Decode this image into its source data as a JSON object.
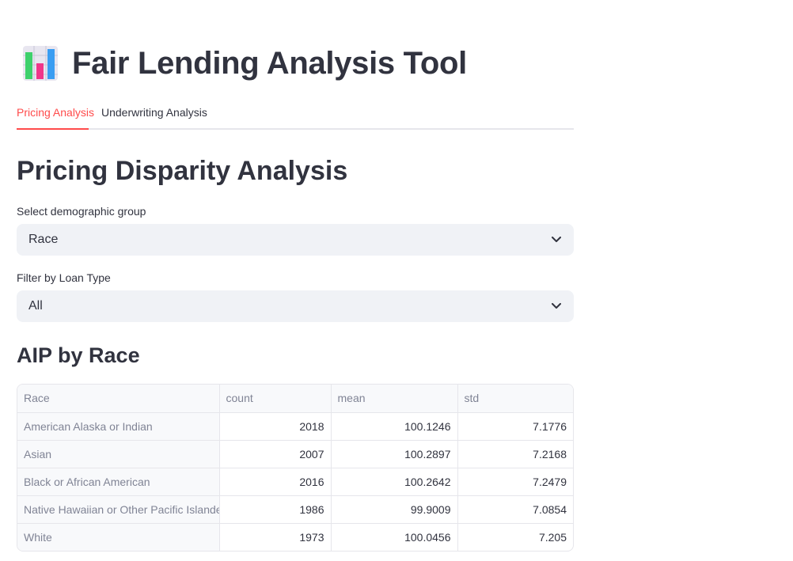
{
  "app": {
    "title": "Fair Lending Analysis Tool",
    "icon": "bar-chart-icon"
  },
  "tabs": [
    {
      "label": "Pricing Analysis",
      "active": true
    },
    {
      "label": "Underwriting Analysis",
      "active": false
    }
  ],
  "main": {
    "heading": "Pricing Disparity Analysis",
    "demographic_select": {
      "label": "Select demographic group",
      "value": "Race"
    },
    "loan_type_select": {
      "label": "Filter by Loan Type",
      "value": "All"
    },
    "subheading": "AIP by Race",
    "table": {
      "columns": [
        "Race",
        "count",
        "mean",
        "std"
      ],
      "rows": [
        [
          "American Alaska or Indian",
          "2018",
          "100.1246",
          "7.1776"
        ],
        [
          "Asian",
          "2007",
          "100.2897",
          "7.2168"
        ],
        [
          "Black or African American",
          "2016",
          "100.2642",
          "7.2479"
        ],
        [
          "Native Hawaiian or Other Pacific Islander",
          "1986",
          "99.9009",
          "7.0854"
        ],
        [
          "White",
          "1973",
          "100.0456",
          "7.205"
        ]
      ]
    }
  },
  "colors": {
    "accent": "#ff4b4b",
    "text": "#31333f",
    "muted": "#808495",
    "input_bg": "#f0f2f6"
  }
}
